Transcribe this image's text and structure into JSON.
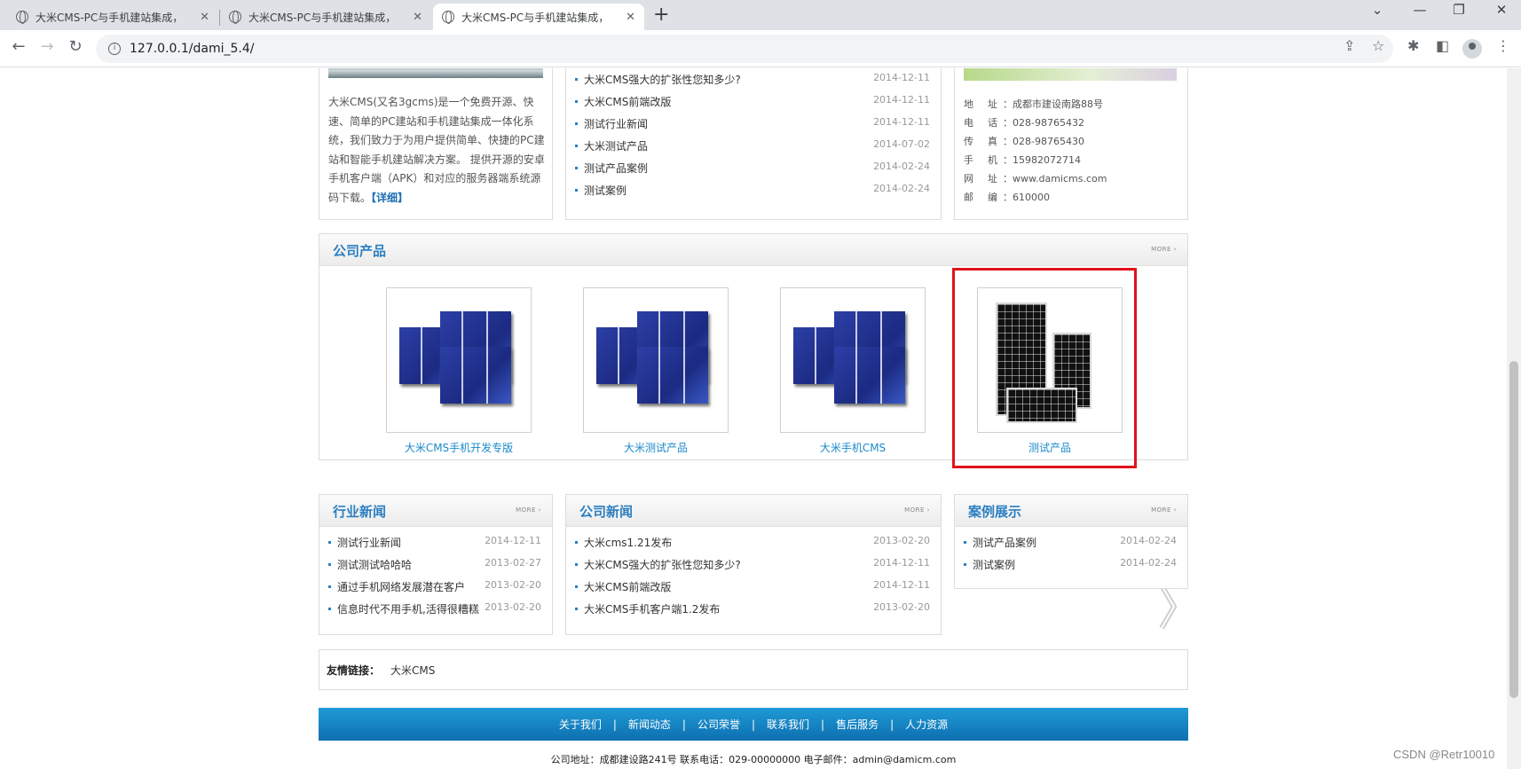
{
  "browser": {
    "tabs": [
      {
        "title": "大米CMS-PC与手机建站集成，"
      },
      {
        "title": "大米CMS-PC与手机建站集成，"
      },
      {
        "title": "大米CMS-PC与手机建站集成，"
      }
    ],
    "url": "127.0.0.1/dami_5.4/"
  },
  "about": {
    "text": "大米CMS(又名3gcms)是一个免费开源、快速、简单的PC建站和手机建站集成一体化系统，我们致力于为用户提供简单、快捷的PC建站和智能手机建站解决方案。 提供开源的安卓手机客户端（APK）和对应的服务器端系统源码下载。",
    "detail_link": "【详细】"
  },
  "top_news": [
    {
      "title": "大米CMS强大的扩张性您知多少?",
      "date": "2014-12-11"
    },
    {
      "title": "大米CMS前端改版",
      "date": "2014-12-11"
    },
    {
      "title": "测试行业新闻",
      "date": "2014-12-11"
    },
    {
      "title": "大米测试产品",
      "date": "2014-07-02"
    },
    {
      "title": "测试产品案例",
      "date": "2014-02-24"
    },
    {
      "title": "测试案例",
      "date": "2014-02-24"
    }
  ],
  "contact": [
    {
      "key": "地址",
      "value": "成都市建设南路88号"
    },
    {
      "key": "电话",
      "value": "028-98765432"
    },
    {
      "key": "传真",
      "value": "028-98765430"
    },
    {
      "key": "手机",
      "value": "15982072714"
    },
    {
      "key": "网址",
      "value": "www.damicms.com"
    },
    {
      "key": "邮编",
      "value": "610000"
    }
  ],
  "products": {
    "title": "公司产品",
    "more": "MORE ›",
    "items": [
      {
        "name": "大米CMS手机开发专版",
        "image": "blue-solar-cells"
      },
      {
        "name": "大米测试产品",
        "image": "blue-solar-cells"
      },
      {
        "name": "大米手机CMS",
        "image": "blue-solar-cells"
      },
      {
        "name": "测试产品",
        "image": "black-solar-panels",
        "highlighted": true
      }
    ]
  },
  "industry_news": {
    "title": "行业新闻",
    "more": "MORE ›",
    "items": [
      {
        "title": "测试行业新闻",
        "date": "2014-12-11"
      },
      {
        "title": "测试测试哈哈哈",
        "date": "2013-02-27"
      },
      {
        "title": "通过手机网络发展潜在客户",
        "date": "2013-02-20"
      },
      {
        "title": "信息时代不用手机,活得很糟糕",
        "date": "2013-02-20"
      }
    ]
  },
  "company_news": {
    "title": "公司新闻",
    "more": "MORE ›",
    "items": [
      {
        "title": "大米cms1.21发布",
        "date": "2013-02-20"
      },
      {
        "title": "大米CMS强大的扩张性您知多少?",
        "date": "2014-12-11"
      },
      {
        "title": "大米CMS前端改版",
        "date": "2014-12-11"
      },
      {
        "title": "大米CMS手机客户端1.2发布",
        "date": "2013-02-20"
      }
    ]
  },
  "cases": {
    "title": "案例展示",
    "more": "MORE ›",
    "items": [
      {
        "title": "测试产品案例",
        "date": "2014-02-24"
      },
      {
        "title": "测试案例",
        "date": "2014-02-24"
      }
    ]
  },
  "friend_links": {
    "label": "友情链接：",
    "links": [
      "大米CMS"
    ]
  },
  "footer": {
    "nav": [
      "关于我们",
      "新闻动态",
      "公司荣誉",
      "联系我们",
      "售后服务",
      "人力资源"
    ],
    "separator": "|",
    "address": "公司地址：成都建设路241号 联系电话：029-00000000 电子邮件：admin@damicm.com"
  },
  "watermark": "CSDN @Retr10010",
  "colors": {
    "accent": "#2b7fc1",
    "footer_bar": "#1583c6",
    "highlight": "#e0131b"
  }
}
